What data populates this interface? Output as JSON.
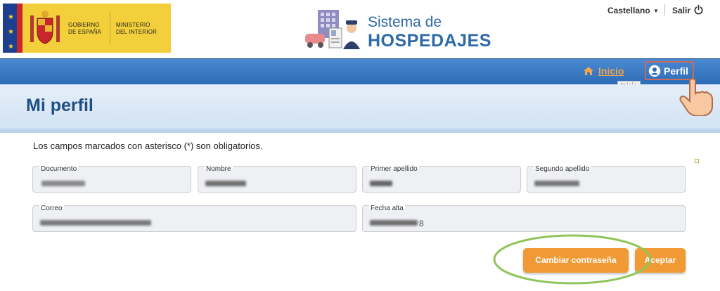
{
  "header": {
    "gov_line1": "GOBIERNO",
    "gov_line2": "DE ESPAÑA",
    "ministry_line1": "MINISTERIO",
    "ministry_line2": "DEL INTERIOR",
    "brand_title_line1": "Sistema de",
    "brand_title_line2": "HOSPEDAJES",
    "language": "Castellano",
    "logout": "Salir"
  },
  "nav": {
    "home_label": "Inicio",
    "profile_label": "Perfil",
    "tooltip": "Inicio"
  },
  "page": {
    "title": "Mi perfil",
    "required_note": "Los campos marcados con asterisco (*) son obligatorios."
  },
  "form": {
    "documento_label": "Documento",
    "nombre_label": "Nombre",
    "primer_apellido_label": "Primer apellido",
    "segundo_apellido_label": "Segundo apellido",
    "correo_label": "Correo",
    "fecha_alta_label": "Fecha alta",
    "fecha_alta_visible_suffix": "8"
  },
  "buttons": {
    "change_password": "Cambiar contraseña",
    "accept": "Aceptar"
  },
  "colors": {
    "accent_orange": "#f19a35",
    "nav_blue": "#2c6bb5",
    "title_blue": "#1f4f85",
    "highlight_green": "#8fc55a"
  }
}
